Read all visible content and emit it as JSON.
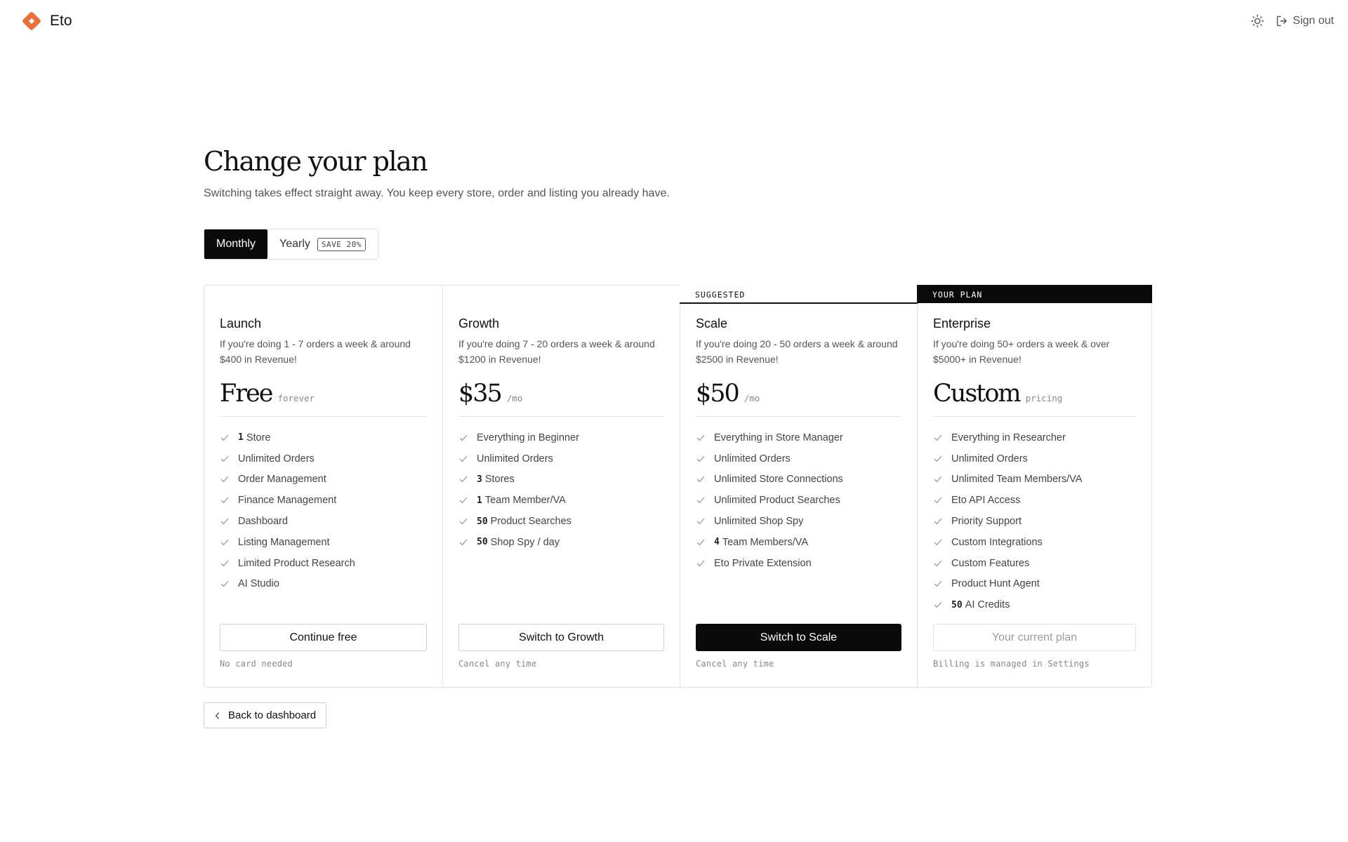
{
  "app": {
    "name": "Eto"
  },
  "header": {
    "theme_icon": "sun-icon",
    "signout_label": "Sign out",
    "signout_icon": "sign-out-icon"
  },
  "page": {
    "title": "Change your plan",
    "subtitle": "Switching takes effect straight away. You keep every store, order and listing you already have."
  },
  "billing_toggle": {
    "monthly": "Monthly",
    "yearly": "Yearly",
    "badge": "SAVE 20%",
    "selected": "Monthly"
  },
  "plans": [
    {
      "name": "Launch",
      "flag": "",
      "description": "If you're doing 1 - 7 orders a week & around $400 in Revenue!",
      "price": "Free",
      "unit": "forever",
      "features": [
        {
          "num": "1",
          "text": "Store"
        },
        {
          "num": "",
          "text": "Unlimited Orders"
        },
        {
          "num": "",
          "text": "Order Management"
        },
        {
          "num": "",
          "text": "Finance Management"
        },
        {
          "num": "",
          "text": "Dashboard"
        },
        {
          "num": "",
          "text": "Listing Management"
        },
        {
          "num": "",
          "text": "Limited Product Research"
        },
        {
          "num": "",
          "text": "AI Studio"
        }
      ],
      "cta": "Continue free",
      "cta_style": "outline",
      "note": "No card needed"
    },
    {
      "name": "Growth",
      "flag": "",
      "description": "If you're doing 7 - 20 orders a week & around $1200 in Revenue!",
      "price": "$35",
      "unit": "/mo",
      "features": [
        {
          "num": "",
          "text": "Everything in Beginner"
        },
        {
          "num": "",
          "text": "Unlimited Orders"
        },
        {
          "num": "3",
          "text": "Stores"
        },
        {
          "num": "1",
          "text": "Team Member/VA"
        },
        {
          "num": "50",
          "text": "Product Searches"
        },
        {
          "num": "50",
          "text": "Shop Spy / day"
        }
      ],
      "cta": "Switch to Growth",
      "cta_style": "outline",
      "note": "Cancel any time"
    },
    {
      "name": "Scale",
      "flag": "SUGGESTED",
      "description": "If you're doing 20 - 50 orders a week & around $2500 in Revenue!",
      "price": "$50",
      "unit": "/mo",
      "features": [
        {
          "num": "",
          "text": "Everything in Store Manager"
        },
        {
          "num": "",
          "text": "Unlimited Orders"
        },
        {
          "num": "",
          "text": "Unlimited Store Connections"
        },
        {
          "num": "",
          "text": "Unlimited Product Searches"
        },
        {
          "num": "",
          "text": "Unlimited Shop Spy"
        },
        {
          "num": "4",
          "text": "Team Members/VA"
        },
        {
          "num": "",
          "text": "Eto Private Extension"
        }
      ],
      "cta": "Switch to Scale",
      "cta_style": "primary",
      "note": "Cancel any time"
    },
    {
      "name": "Enterprise",
      "flag": "YOUR PLAN",
      "description": "If you're doing 50+ orders a week & over $5000+ in Revenue!",
      "price": "Custom",
      "unit": "pricing",
      "features": [
        {
          "num": "",
          "text": "Everything in Researcher"
        },
        {
          "num": "",
          "text": "Unlimited Orders"
        },
        {
          "num": "",
          "text": "Unlimited Team Members/VA"
        },
        {
          "num": "",
          "text": "Eto API Access"
        },
        {
          "num": "",
          "text": "Priority Support"
        },
        {
          "num": "",
          "text": "Custom Integrations"
        },
        {
          "num": "",
          "text": "Custom Features"
        },
        {
          "num": "",
          "text": "Product Hunt Agent"
        },
        {
          "num": "50",
          "text": "AI Credits"
        }
      ],
      "cta": "Your current plan",
      "cta_style": "disabled",
      "note": "Billing is managed in Settings"
    }
  ],
  "footer": {
    "back_label": "Back to dashboard",
    "back_icon": "chevron-left-icon"
  },
  "colors": {
    "accent": "#e8703a",
    "primary": "#0a0a0a",
    "border": "#e2e2e2",
    "muted": "#555555"
  }
}
